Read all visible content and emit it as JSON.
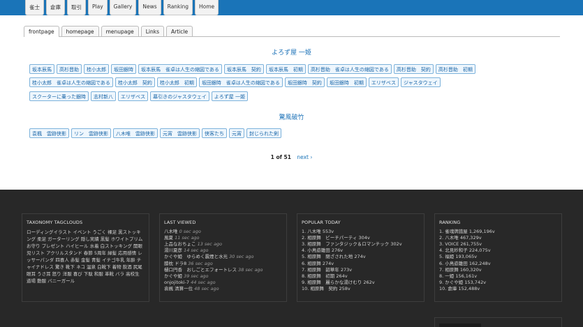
{
  "topnav": [
    "雀士",
    "倉庫",
    "取引",
    "Play",
    "Gallery",
    "News",
    "Ranking",
    "Home"
  ],
  "subtabs": [
    "frontpage",
    "homepage",
    "menupage",
    "Links",
    "Article"
  ],
  "section1": {
    "title": "よろず屋 一姫",
    "rows": [
      [
        "坂本辰馬",
        "高杉晋助",
        "桂小太郎",
        "坂田銀時",
        "坂本辰馬　雀卓は人生の縮図である",
        "坂本辰馬　契約",
        "坂本辰馬　初期",
        "高杉晋助　雀卓は人生の縮図である",
        "高杉晋助　契約",
        "高杉晋助　初期"
      ],
      [
        "桂小太郎　雀卓は人生の縮図である",
        "桂小太郎　契約",
        "桂小太郎　初期",
        "坂田銀時　雀卓は人生の縮図である",
        "坂田銀時　契約",
        "坂田銀時　初期",
        "エリザベス",
        "ジャスタウェイ"
      ],
      [
        "スクーターに乗った銀時",
        "志村新八",
        "エリザベス",
        "幕引きのジャスタウェイ",
        "よろず屋 一姫"
      ]
    ]
  },
  "section2": {
    "title": "驚風破竹",
    "rows": [
      [
        "袁楓　雲跡侠影",
        "リン　雲跡侠影",
        "八木唯　雲跡侠影",
        "元宵　雲跡侠影",
        "侠客たち",
        "元宵",
        "封じられた剣"
      ]
    ]
  },
  "pager": {
    "current": "1 of 51",
    "next": "next ›"
  },
  "footer": {
    "taxonomy": {
      "title": "TAXONOMY TAGCLOUDS",
      "text": "ローディングイラスト イベント うごく 裸足 黒ストッキング 柔足 ガーターリング 隠し実績 黒髪 ホワイトプリム お守り プレゼント ハイヒール 水着 白ストッキング 開眼児リスト アクリルスタンド 春節 5周年 緑髪 応用感情 レッサーパンダ 四喜人 赤髪 金髪 青髪 イチゴ牛乳 年齢 チャイナドレス 驚き 靴下 ネコ 温泉 白靴下 着物 飲酒 尻尾 眼耳 うさ耳 怒り 洋服 喜び 下駄 和服 革靴 バラ 高校生 道場 動服 バニーガール"
    },
    "last_viewed": {
      "title": "LAST VIEWED",
      "items": [
        {
          "name": "八木唯",
          "ago": "0 sec ago"
        },
        {
          "name": "風夏",
          "ago": "11 sec ago"
        },
        {
          "name": "上品なおちょこ",
          "ago": "13 sec ago"
        },
        {
          "name": "湯川夏彦",
          "ago": "14 sec ago"
        },
        {
          "name": "かぐや姫　ゆらめく震煙と水光",
          "ago": "30 sec ago"
        },
        {
          "name": "膝枕 ドラ8",
          "ago": "36 sec ago"
        },
        {
          "name": "樋口円香　おしごとエフォートレス",
          "ago": "38 sec ago"
        },
        {
          "name": "かぐや姫",
          "ago": "39 sec ago"
        },
        {
          "name": "onjojitoki-7",
          "ago": "44 sec ago"
        },
        {
          "name": "袁楓 清算一位",
          "ago": "48 sec ago"
        }
      ]
    },
    "popular": {
      "title": "POPULAR TODAY",
      "items": [
        "1. 八木唯 553v",
        "2. 相原舞　ビーチパーティ 304v",
        "3. 相原舞　ファンタジック＆ロマンチック 302v",
        "4. 小鳥遊雛田 276v",
        "5. 相原舞　閉ざされた地 274v",
        "6. 相原舞 274v",
        "7. 相原舞　韶華年 273v",
        "8. 相原舞　初期 264v",
        "9. 相原舞　麗らかな湯けむり 262v",
        "10. 相原舞　契約 258v"
      ]
    },
    "ranking": {
      "title": "RANKING",
      "items": [
        "1. 雀魂牌譜屋 1,269,196v",
        "2. 八木唯 467,329v",
        "3. VOICE 261,755v",
        "4. 北見紗和子 224,075v",
        "5. 福姫 193,065v",
        "6. 小鳥遊雛田 162,248v",
        "7. 相原舞 160,320v",
        "8. 一姫 156,161v",
        "9. かぐや姫 153,742v",
        "10. 倉庫 152,488v"
      ]
    }
  }
}
